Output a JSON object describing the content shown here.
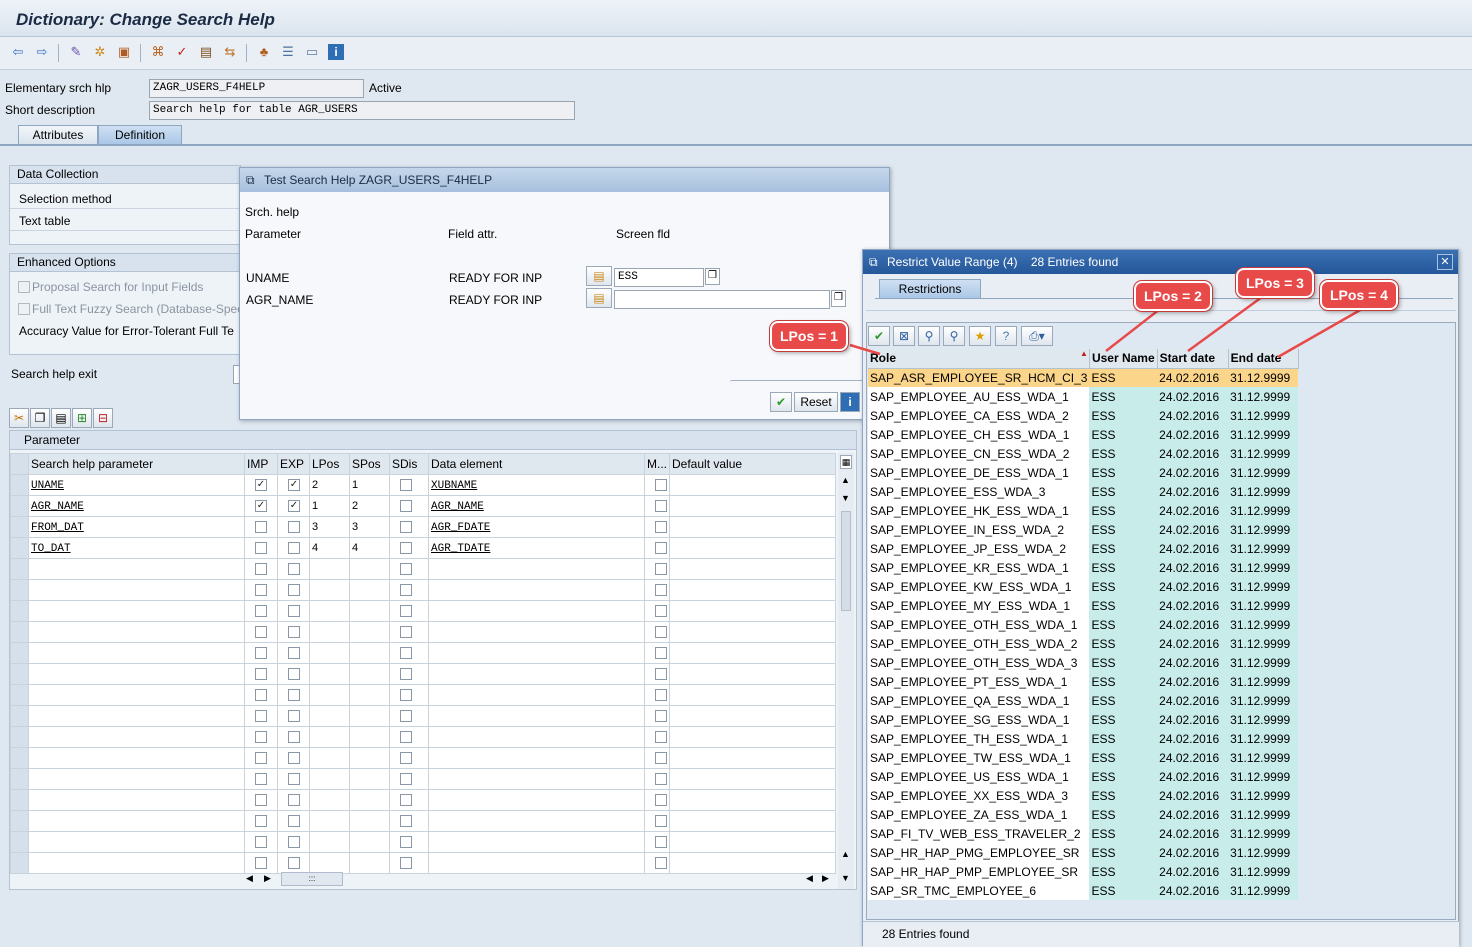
{
  "window": {
    "title": "Dictionary: Change Search Help"
  },
  "toolbar": {
    "icons": [
      "back-icon",
      "forward-icon",
      "display-change-icon",
      "activate-icon",
      "other-object-icon",
      "hierarchy-icon",
      "check-icon",
      "where-used-icon",
      "navigate-icon",
      "tree-icon",
      "enhancements-icon",
      "layout-icon",
      "info-icon"
    ]
  },
  "header": {
    "elementary_label": "Elementary srch hlp",
    "elementary_value": "ZAGR_USERS_F4HELP",
    "status": "Active",
    "short_desc_label": "Short description",
    "short_desc_value": "Search help for table AGR_USERS"
  },
  "tabs": [
    {
      "label": "Attributes"
    },
    {
      "label": "Definition"
    }
  ],
  "data_collection": {
    "title": "Data Collection",
    "selection_method": "Selection method",
    "text_table": "Text table"
  },
  "enhanced": {
    "title": "Enhanced Options",
    "proposal": "Proposal Search for Input Fields",
    "fuzzy": "Full Text Fuzzy Search (Database-Spec",
    "accuracy": "Accuracy Value for Error-Tolerant Full Te"
  },
  "search_help_exit": "Search help exit",
  "param_table": {
    "title": "Parameter",
    "headers": [
      "Search help parameter",
      "IMP",
      "EXP",
      "LPos",
      "SPos",
      "SDis",
      "Data element",
      "M...",
      "Default value"
    ],
    "rows": [
      {
        "name": "UNAME",
        "imp": true,
        "exp": true,
        "lpos": "2",
        "spos": "1",
        "element": "XUBNAME"
      },
      {
        "name": "AGR_NAME",
        "imp": true,
        "exp": true,
        "lpos": "1",
        "spos": "2",
        "element": "AGR_NAME"
      },
      {
        "name": "FROM_DAT",
        "imp": false,
        "exp": false,
        "lpos": "3",
        "spos": "3",
        "element": "AGR_FDATE"
      },
      {
        "name": "TO_DAT",
        "imp": false,
        "exp": false,
        "lpos": "4",
        "spos": "4",
        "element": "AGR_TDATE"
      }
    ],
    "empty_rows": 15
  },
  "test_dialog": {
    "title": "Test Search Help ZAGR_USERS_F4HELP",
    "srch_help": "Srch. help",
    "col_parameter": "Parameter",
    "col_field_attr": "Field attr.",
    "col_screen_fld": "Screen fld",
    "rows": [
      {
        "param": "UNAME",
        "attr": "READY FOR INP",
        "value": "ESS"
      },
      {
        "param": "AGR_NAME",
        "attr": "READY FOR INP",
        "value": ""
      }
    ],
    "reset_label": "Reset"
  },
  "restrict_dialog": {
    "title": "Restrict Value Range (4)",
    "entries_found": "28 Entries found",
    "tab_label": "Restrictions",
    "headers": [
      "Role",
      "User Name",
      "Start date",
      "End date"
    ],
    "rows": [
      [
        "SAP_ASR_EMPLOYEE_SR_HCM_CI_3",
        "ESS",
        "24.02.2016",
        "31.12.9999"
      ],
      [
        "SAP_EMPLOYEE_AU_ESS_WDA_1",
        "ESS",
        "24.02.2016",
        "31.12.9999"
      ],
      [
        "SAP_EMPLOYEE_CA_ESS_WDA_2",
        "ESS",
        "24.02.2016",
        "31.12.9999"
      ],
      [
        "SAP_EMPLOYEE_CH_ESS_WDA_1",
        "ESS",
        "24.02.2016",
        "31.12.9999"
      ],
      [
        "SAP_EMPLOYEE_CN_ESS_WDA_2",
        "ESS",
        "24.02.2016",
        "31.12.9999"
      ],
      [
        "SAP_EMPLOYEE_DE_ESS_WDA_1",
        "ESS",
        "24.02.2016",
        "31.12.9999"
      ],
      [
        "SAP_EMPLOYEE_ESS_WDA_3",
        "ESS",
        "24.02.2016",
        "31.12.9999"
      ],
      [
        "SAP_EMPLOYEE_HK_ESS_WDA_1",
        "ESS",
        "24.02.2016",
        "31.12.9999"
      ],
      [
        "SAP_EMPLOYEE_IN_ESS_WDA_2",
        "ESS",
        "24.02.2016",
        "31.12.9999"
      ],
      [
        "SAP_EMPLOYEE_JP_ESS_WDA_2",
        "ESS",
        "24.02.2016",
        "31.12.9999"
      ],
      [
        "SAP_EMPLOYEE_KR_ESS_WDA_1",
        "ESS",
        "24.02.2016",
        "31.12.9999"
      ],
      [
        "SAP_EMPLOYEE_KW_ESS_WDA_1",
        "ESS",
        "24.02.2016",
        "31.12.9999"
      ],
      [
        "SAP_EMPLOYEE_MY_ESS_WDA_1",
        "ESS",
        "24.02.2016",
        "31.12.9999"
      ],
      [
        "SAP_EMPLOYEE_OTH_ESS_WDA_1",
        "ESS",
        "24.02.2016",
        "31.12.9999"
      ],
      [
        "SAP_EMPLOYEE_OTH_ESS_WDA_2",
        "ESS",
        "24.02.2016",
        "31.12.9999"
      ],
      [
        "SAP_EMPLOYEE_OTH_ESS_WDA_3",
        "ESS",
        "24.02.2016",
        "31.12.9999"
      ],
      [
        "SAP_EMPLOYEE_PT_ESS_WDA_1",
        "ESS",
        "24.02.2016",
        "31.12.9999"
      ],
      [
        "SAP_EMPLOYEE_QA_ESS_WDA_1",
        "ESS",
        "24.02.2016",
        "31.12.9999"
      ],
      [
        "SAP_EMPLOYEE_SG_ESS_WDA_1",
        "ESS",
        "24.02.2016",
        "31.12.9999"
      ],
      [
        "SAP_EMPLOYEE_TH_ESS_WDA_1",
        "ESS",
        "24.02.2016",
        "31.12.9999"
      ],
      [
        "SAP_EMPLOYEE_TW_ESS_WDA_1",
        "ESS",
        "24.02.2016",
        "31.12.9999"
      ],
      [
        "SAP_EMPLOYEE_US_ESS_WDA_1",
        "ESS",
        "24.02.2016",
        "31.12.9999"
      ],
      [
        "SAP_EMPLOYEE_XX_ESS_WDA_3",
        "ESS",
        "24.02.2016",
        "31.12.9999"
      ],
      [
        "SAP_EMPLOYEE_ZA_ESS_WDA_1",
        "ESS",
        "24.02.2016",
        "31.12.9999"
      ],
      [
        "SAP_FI_TV_WEB_ESS_TRAVELER_2",
        "ESS",
        "24.02.2016",
        "31.12.9999"
      ],
      [
        "SAP_HR_HAP_PMG_EMPLOYEE_SR",
        "ESS",
        "24.02.2016",
        "31.12.9999"
      ],
      [
        "SAP_HR_HAP_PMP_EMPLOYEE_SR",
        "ESS",
        "24.02.2016",
        "31.12.9999"
      ],
      [
        "SAP_SR_TMC_EMPLOYEE_6",
        "ESS",
        "24.02.2016",
        "31.12.9999"
      ]
    ],
    "footer": "28 Entries found"
  },
  "callouts": [
    "LPos = 1",
    "LPos = 2",
    "LPos = 3",
    "LPos = 4"
  ],
  "colors": {
    "accent": "#e84a4a",
    "highlight": "#fbd58a",
    "cell": "#c7ecea"
  }
}
